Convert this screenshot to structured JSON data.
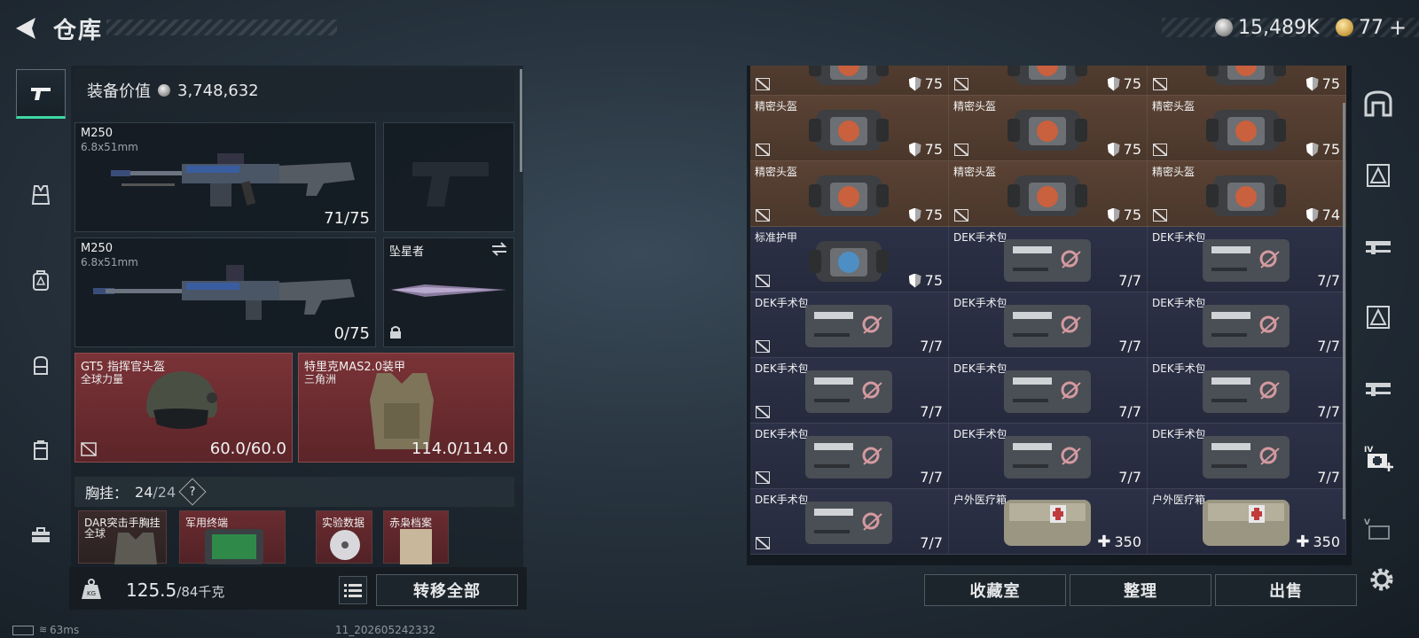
{
  "header": {
    "title": "仓库",
    "silver_amount": "15,489K",
    "gold_amount": "77",
    "gold_plus": "+"
  },
  "loadout": {
    "value_label": "装备价值",
    "value_amount": "3,748,632",
    "primary": {
      "name": "M250",
      "ammo": "6.8x51mm",
      "durability": "71/75"
    },
    "secondary": {
      "name": "M250",
      "ammo": "6.8x51mm",
      "durability": "0/75"
    },
    "melee": {
      "name": "坠星者"
    },
    "helmet": {
      "name": "GT5 指挥官头盔",
      "brand": "全球力量",
      "durability": "60.0/60.0"
    },
    "armor": {
      "name": "特里克MAS2.0装甲",
      "brand": "三角洲",
      "durability": "114.0/114.0"
    },
    "chest_label": "胸挂：",
    "chest_count": "24",
    "chest_cap": "/24",
    "chest_help": "?",
    "mini_items": [
      "DAR突击手胸挂",
      "全球",
      "军用终端",
      "实验数据",
      "赤枭档案"
    ]
  },
  "footer_left": {
    "weight_current": "125.5",
    "weight_max": "/84千克",
    "weight_icon_label": "KG",
    "transfer_all": "转移全部"
  },
  "status": {
    "ping": "63ms",
    "session_id": "11_202605242332"
  },
  "stash": {
    "rows": [
      {
        "color": "brown",
        "cells": [
          {
            "name": "",
            "value": "75",
            "kind": "shield"
          },
          {
            "name": "",
            "value": "75",
            "kind": "shield"
          },
          {
            "name": "",
            "value": "75",
            "kind": "shield"
          }
        ]
      },
      {
        "color": "brown",
        "cells": [
          {
            "name": "精密头盔",
            "value": "75",
            "kind": "shield"
          },
          {
            "name": "精密头盔",
            "value": "75",
            "kind": "shield"
          },
          {
            "name": "精密头盔",
            "value": "75",
            "kind": "shield"
          }
        ]
      },
      {
        "color": "brown",
        "cells": [
          {
            "name": "精密头盔",
            "value": "75",
            "kind": "shield"
          },
          {
            "name": "精密头盔",
            "value": "75",
            "kind": "shield"
          },
          {
            "name": "精密头盔",
            "value": "74",
            "kind": "shield"
          }
        ]
      },
      {
        "color": "navy",
        "cells": [
          {
            "name": "标准护甲",
            "value": "75",
            "kind": "shield"
          },
          {
            "name": "DEK手术包",
            "value": "7/7",
            "kind": "count"
          },
          {
            "name": "DEK手术包",
            "value": "7/7",
            "kind": "count"
          }
        ]
      },
      {
        "color": "navy",
        "cells": [
          {
            "name": "DEK手术包",
            "value": "7/7",
            "kind": "count"
          },
          {
            "name": "DEK手术包",
            "value": "7/7",
            "kind": "count"
          },
          {
            "name": "DEK手术包",
            "value": "7/7",
            "kind": "count"
          }
        ]
      },
      {
        "color": "navy",
        "cells": [
          {
            "name": "DEK手术包",
            "value": "7/7",
            "kind": "count"
          },
          {
            "name": "DEK手术包",
            "value": "7/7",
            "kind": "count"
          },
          {
            "name": "DEK手术包",
            "value": "7/7",
            "kind": "count"
          }
        ]
      },
      {
        "color": "navy",
        "cells": [
          {
            "name": "DEK手术包",
            "value": "7/7",
            "kind": "count"
          },
          {
            "name": "DEK手术包",
            "value": "7/7",
            "kind": "count"
          },
          {
            "name": "DEK手术包",
            "value": "7/7",
            "kind": "count"
          }
        ]
      },
      {
        "color": "navy",
        "cells": [
          {
            "name": "DEK手术包",
            "value": "7/7",
            "kind": "count"
          },
          {
            "name": "户外医疗箱",
            "value": "350",
            "kind": "heal"
          },
          {
            "name": "户外医疗箱",
            "value": "350",
            "kind": "heal"
          }
        ]
      }
    ]
  },
  "actions": {
    "collection": "收藏室",
    "organize": "整理",
    "sell": "出售"
  },
  "right_nav": {
    "tier4": "IV",
    "tier5": "V"
  }
}
